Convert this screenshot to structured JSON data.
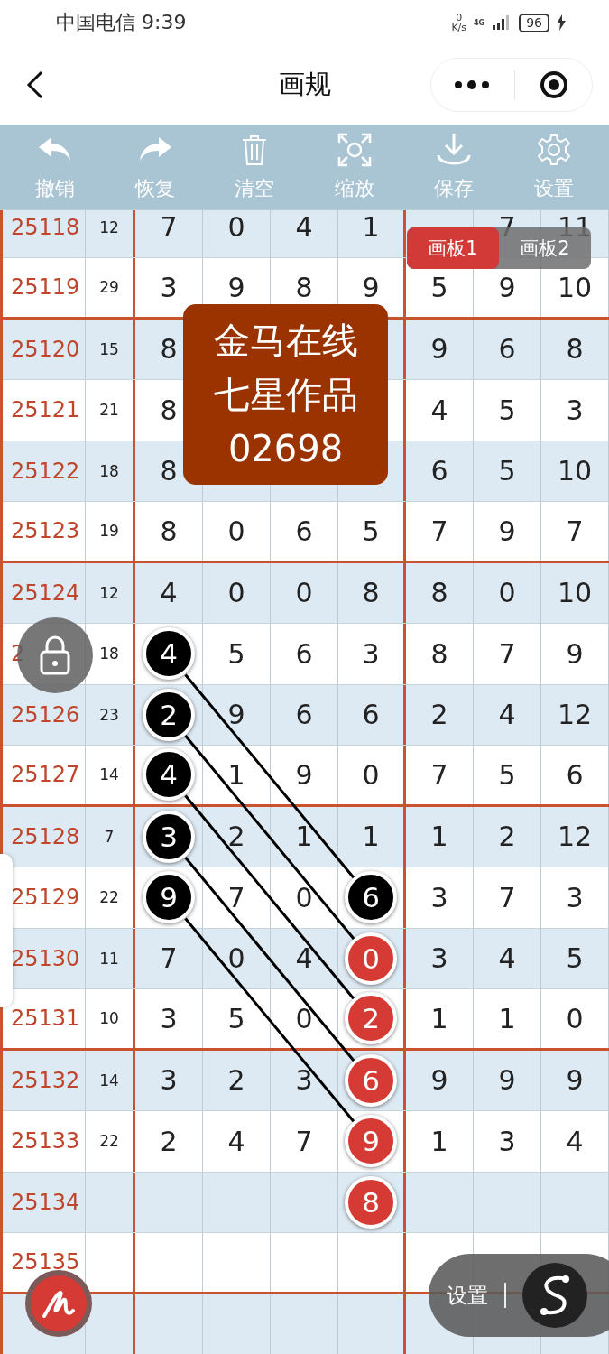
{
  "status_bar": {
    "carrier_time": "中国电信 9:39",
    "net_speed": "0",
    "net_unit": "K/s",
    "network": "4G",
    "battery": "96"
  },
  "header": {
    "title": "画规"
  },
  "toolbar": [
    {
      "label": "撤销"
    },
    {
      "label": "恢复"
    },
    {
      "label": "清空"
    },
    {
      "label": "缩放"
    },
    {
      "label": "保存"
    },
    {
      "label": "设置"
    }
  ],
  "board_tabs": [
    {
      "label": "画板1",
      "selected": true
    },
    {
      "label": "画板2",
      "selected": false
    }
  ],
  "stamp": {
    "lines": [
      "金马在线",
      "七星作品",
      "02698"
    ]
  },
  "table": {
    "rows": [
      {
        "period": "25118",
        "sum": "12",
        "cells": [
          "7",
          "0",
          "4",
          "1",
          null,
          "7",
          "11"
        ]
      },
      {
        "period": "25119",
        "sum": "29",
        "cells": [
          "3",
          "9",
          "8",
          "9",
          "5",
          "9",
          "10"
        ]
      },
      {
        "period": "25120",
        "sum": "15",
        "cells": [
          "8",
          null,
          null,
          null,
          "9",
          "6",
          "8"
        ]
      },
      {
        "period": "25121",
        "sum": "21",
        "cells": [
          "8",
          null,
          null,
          null,
          "4",
          "5",
          "3"
        ]
      },
      {
        "period": "25122",
        "sum": "18",
        "cells": [
          "8",
          null,
          null,
          null,
          "6",
          "5",
          "10"
        ]
      },
      {
        "period": "25123",
        "sum": "19",
        "cells": [
          "8",
          "0",
          "6",
          "5",
          "7",
          "9",
          "7"
        ]
      },
      {
        "period": "25124",
        "sum": "12",
        "cells": [
          "4",
          "0",
          "0",
          "8",
          "8",
          "0",
          "10"
        ]
      },
      {
        "period": "2",
        "sum": "18",
        "cells": [
          {
            "kind": "black",
            "text": "4"
          },
          "5",
          "6",
          "3",
          "8",
          "7",
          "9"
        ]
      },
      {
        "period": "25126",
        "sum": "23",
        "cells": [
          {
            "kind": "black",
            "text": "2"
          },
          "9",
          "6",
          "6",
          "2",
          "4",
          "12"
        ]
      },
      {
        "period": "25127",
        "sum": "14",
        "cells": [
          {
            "kind": "black",
            "text": "4"
          },
          "1",
          "9",
          "0",
          "7",
          "5",
          "6"
        ]
      },
      {
        "period": "25128",
        "sum": "7",
        "cells": [
          {
            "kind": "black",
            "text": "3"
          },
          "2",
          "1",
          "1",
          "1",
          "2",
          "12"
        ]
      },
      {
        "period": "25129",
        "sum": "22",
        "cells": [
          {
            "kind": "black",
            "text": "9"
          },
          "7",
          "0",
          {
            "kind": "black",
            "text": "6"
          },
          "3",
          "7",
          "3"
        ]
      },
      {
        "period": "25130",
        "sum": "11",
        "cells": [
          "7",
          "0",
          "4",
          {
            "kind": "red",
            "text": "0"
          },
          "3",
          "4",
          "5"
        ]
      },
      {
        "period": "25131",
        "sum": "10",
        "cells": [
          "3",
          "5",
          "0",
          {
            "kind": "red",
            "text": "2"
          },
          "1",
          "1",
          "0"
        ]
      },
      {
        "period": "25132",
        "sum": "14",
        "cells": [
          "3",
          "2",
          "3",
          {
            "kind": "red",
            "text": "6"
          },
          "9",
          "9",
          "9"
        ]
      },
      {
        "period": "25133",
        "sum": "22",
        "cells": [
          "2",
          "4",
          "7",
          {
            "kind": "red",
            "text": "9"
          },
          "1",
          "3",
          "4"
        ]
      },
      {
        "period": "25134",
        "cells": [
          null,
          null,
          null,
          {
            "kind": "red",
            "text": "8"
          },
          null,
          null,
          null
        ]
      },
      {
        "period": "25135"
      },
      {}
    ]
  },
  "floating": {
    "settings_label": "设置"
  }
}
